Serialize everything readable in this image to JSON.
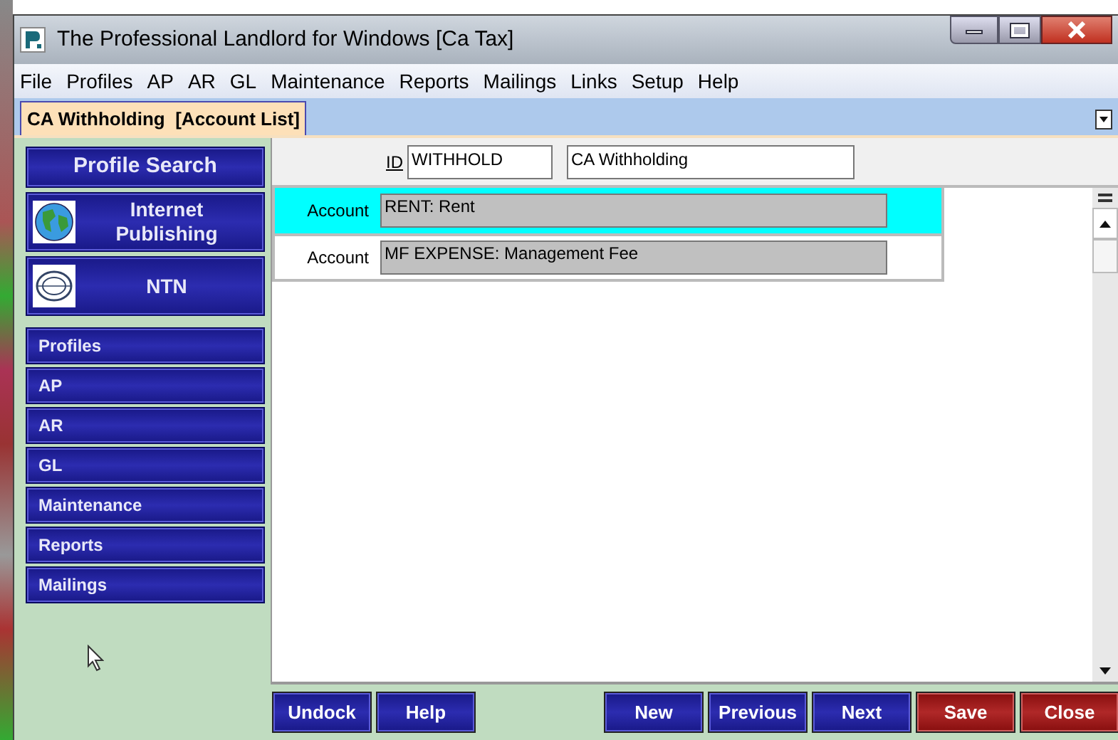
{
  "window": {
    "title": "The Professional Landlord for Windows [Ca Tax]"
  },
  "menu": [
    "File",
    "Profiles",
    "AP",
    "AR",
    "GL",
    "Maintenance",
    "Reports",
    "Mailings",
    "Links",
    "Setup",
    "Help"
  ],
  "tabs": [
    {
      "label": "CA Withholding  [Account List]",
      "selected": true
    }
  ],
  "sidebar": {
    "top_buttons": [
      {
        "label": "Profile Search",
        "kind": "plain"
      },
      {
        "label": "Internet Publishing",
        "kind": "globe"
      },
      {
        "label": "NTN",
        "kind": "ntn"
      }
    ],
    "items": [
      "Profiles",
      "AP",
      "AR",
      "GL",
      "Maintenance",
      "Reports",
      "Mailings"
    ]
  },
  "header": {
    "id_label": "ID",
    "id_value": "WITHHOLD",
    "name_value": "CA Withholding"
  },
  "rows": [
    {
      "label": "Account",
      "value": "RENT: Rent",
      "selected": true
    },
    {
      "label": "Account",
      "value": "MF EXPENSE: Management Fee",
      "selected": false
    }
  ],
  "buttons": [
    {
      "label": "Undock",
      "kind": "blue"
    },
    {
      "label": "Help",
      "kind": "blue"
    },
    {
      "label": "New",
      "kind": "blue"
    },
    {
      "label": "Previous",
      "kind": "blue"
    },
    {
      "label": "Next",
      "kind": "blue"
    },
    {
      "label": "Save",
      "kind": "red"
    },
    {
      "label": "Close",
      "kind": "red"
    }
  ]
}
